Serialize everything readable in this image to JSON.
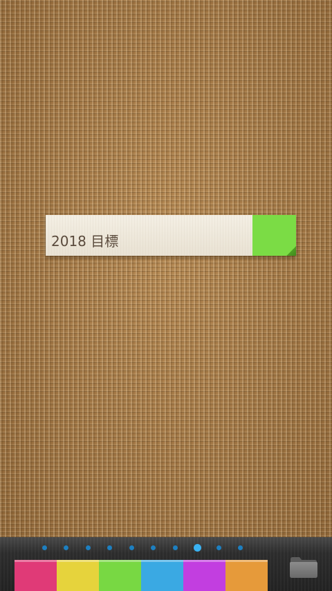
{
  "note": {
    "text": "2018 目標",
    "tab_color": "#7bdc45"
  },
  "pager": {
    "count": 10,
    "active_index": 7
  },
  "palette": {
    "colors": [
      "#e03a77",
      "#e6d33c",
      "#78d843",
      "#3aa9e3",
      "#c23ee0",
      "#e69a3a"
    ]
  },
  "toolbar": {
    "folder_icon": "folder-icon"
  }
}
